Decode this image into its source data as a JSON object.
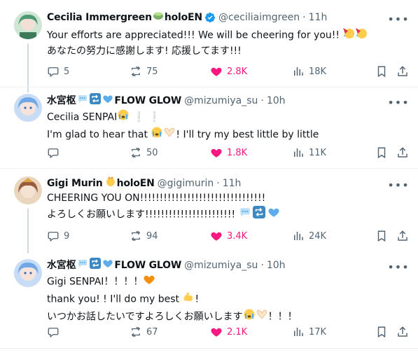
{
  "tweets": [
    {
      "name": "Cecilia Immergreen",
      "name_suffix": "holoEN",
      "handle": "@ceciliaimgreen",
      "time": "11h",
      "lines": [
        "Your efforts are appreciated!!! We will be cheering for you!!",
        "あなたの努力に感謝します! 応援してます!!!"
      ],
      "reply": "5",
      "retweet": "75",
      "like": "2.8K",
      "views": "18K"
    },
    {
      "name": "水宮枢",
      "name_suffix": "FLOW GLOW",
      "handle": "@mizumiya_su",
      "time": "10h",
      "lines": [
        "Cecilia SENPAI",
        "I'm glad to hear that",
        "! I'll try my best little by little"
      ],
      "reply": "",
      "retweet": "50",
      "like": "1.8K",
      "views": "11K"
    },
    {
      "name": "Gigi Murin",
      "name_suffix": "holoEN",
      "handle": "@gigimurin",
      "time": "11h",
      "lines": [
        "CHEERING YOU ON!!!!!!!!!!!!!!!!!!!!!!!!!!!!!!!!",
        "よろしくお願いします!!!!!!!!!!!!!!!!!!!!!!!"
      ],
      "reply": "9",
      "retweet": "94",
      "like": "3.4K",
      "views": "24K"
    },
    {
      "name": "水宮枢",
      "name_suffix": "FLOW GLOW",
      "handle": "@mizumiya_su",
      "time": "10h",
      "lines": [
        "Gigi SENPAI！！！！",
        "thank you! ! I'll do my best",
        "!",
        "いつかお話したいですよろしくお願いします",
        "！！！"
      ],
      "reply": "",
      "retweet": "67",
      "like": "2.1K",
      "views": "17K"
    }
  ],
  "colors": {
    "accent": "#1d9bf0",
    "like": "#f91880",
    "muted": "#536471",
    "text": "#0f1419"
  },
  "icons": [
    "more-icon",
    "reply-icon",
    "retweet-icon",
    "heart-icon",
    "views-icon",
    "bookmark-icon",
    "share-icon",
    "verified-icon"
  ]
}
